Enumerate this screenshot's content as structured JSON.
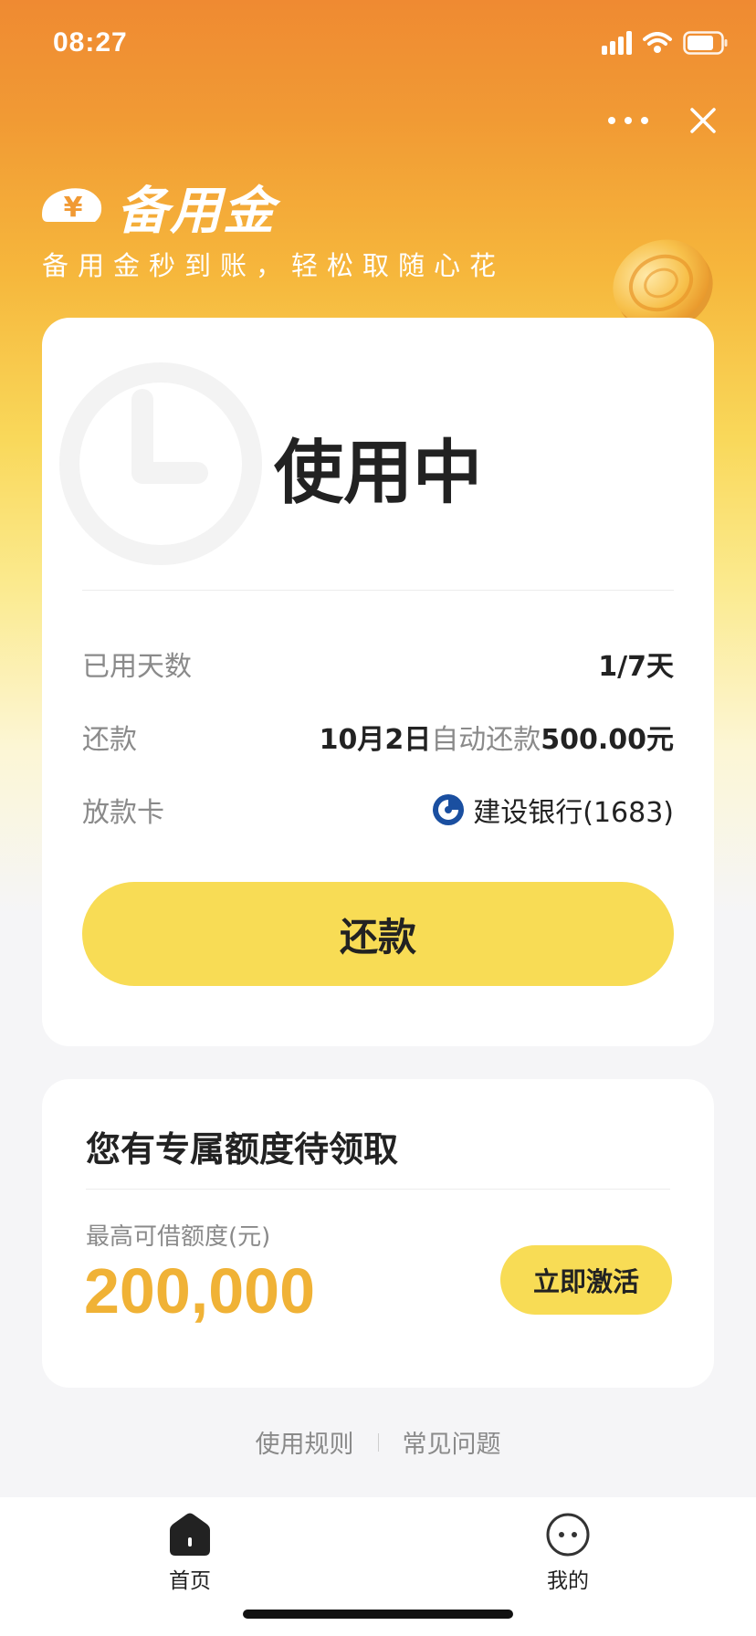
{
  "status_bar": {
    "time": "08:27"
  },
  "header": {
    "brand_title": "备用金",
    "tagline": "备用金秒到账，轻松取随心花",
    "logo_symbol": "¥"
  },
  "usage_card": {
    "status": "使用中",
    "rows": [
      {
        "label": "已用天数",
        "value": "1/7天"
      },
      {
        "label": "还款",
        "date": "10月2日",
        "mode": "自动还款",
        "amount": "500.00元"
      },
      {
        "label": "放款卡",
        "bank": "建设银行(1683)"
      }
    ],
    "repay_button": "还款"
  },
  "credit_card": {
    "title": "您有专属额度待领取",
    "amount_label": "最高可借额度(元)",
    "amount": "200,000",
    "activate_button": "立即激活"
  },
  "footer_links": [
    "使用规则",
    "常见问题"
  ],
  "tab_bar": [
    {
      "label": "首页",
      "icon": "home-icon"
    },
    {
      "label": "我的",
      "icon": "profile-icon"
    }
  ],
  "colors": {
    "accent_yellow": "#f8dc55",
    "amount_orange": "#f0b236",
    "header_orange": "#ef8a32"
  }
}
